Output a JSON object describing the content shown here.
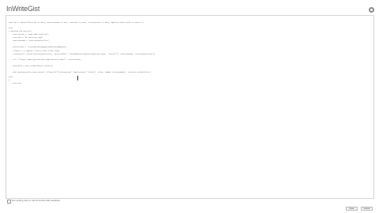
{
  "app": {
    "title": "InWriteGist"
  },
  "editor": {
    "lines": [
      "Function 1 (Generalfunction is Gist, Functionname is Gist, Function is Gist, ArrayLocator is Gist, ApplicationTo Usale is Gist) 11",
      "Gist",
      "{ Backing and Gistro()",
      "    Description = \"Same Name Function\",",
      "    Location = \"Go Function Page\",",
      "    FunctionName = \"FunctionController\",",
      "    AccessToken = \"j7F3s8dK29xLmQ4pRz1vNb6YcW0tHgE5aUoI\",",
      "    Primary = (1 update = Gist) Files Value Item)",
      "    PrimaryFile = Gist(\"FunctionController, AccessToken\", \"FileAndAccessToFunctionMatch(\"Page\", \"Detail\")\", FunctionName, LocationFunction())",
      "    Url = \"https://www.gistfunction.app/function_names\" + AccessToken;",
      "    DataValue = Gist.FromValue(Url.Data());",
      "    Gist.Run(DataValue.Function(Url, @\"Details\"[\"Information\",\"Application\",\"Value\"], Value, Number Value(Number), Location.Value(Files))",
      "Gist",
      "}",
      "    Function"
    ]
  },
  "footer": {
    "checkbox_label": "Run existing code on current function after save/load",
    "button_1": "Save",
    "button_2": "Cancel"
  }
}
